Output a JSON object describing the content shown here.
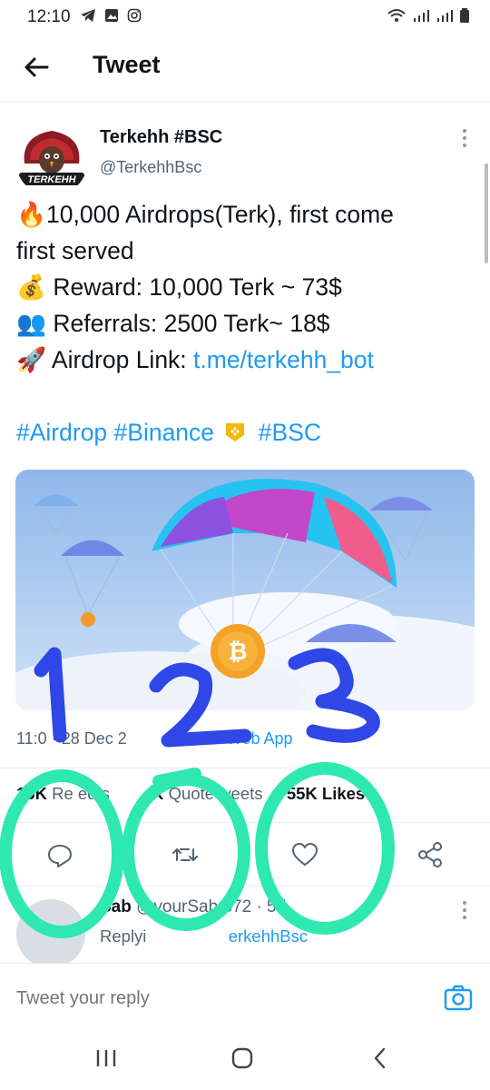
{
  "status_bar": {
    "time": "12:10",
    "left_icons": [
      "telegram-icon",
      "gallery-icon",
      "instagram-icon"
    ],
    "right_icons": [
      "wifi-icon",
      "signal-icon",
      "signal-icon",
      "battery-icon"
    ]
  },
  "app_bar": {
    "title": "Tweet"
  },
  "tweet": {
    "author_name": "Terkehh #BSC",
    "author_handle": "@TerkehhBsc",
    "avatar_text": "TERKEHH",
    "lines": [
      {
        "emoji": "🔥",
        "text": "10,000 Airdrops(Terk), first come"
      },
      {
        "emoji": "",
        "text": "first served"
      },
      {
        "emoji": "💰",
        "text": " Reward: 10,000 Terk ~ 73$"
      },
      {
        "emoji": "👥",
        "text": " Referrals: 2500 Terk~ 18$"
      },
      {
        "emoji": "🚀",
        "text": " Airdrop Link: ",
        "link": "t.me/terkehh_bot"
      }
    ],
    "hashtags": {
      "a": "#Airdrop #Binance",
      "b": "#BSC"
    },
    "meta_visible": {
      "time": "11:0",
      "date": "· 28 Dec 2",
      "source": "Web App"
    },
    "stats": {
      "retweets_count": "15K",
      "retweets_label": "Re  eets",
      "quote_count": "K",
      "quote_label": "Quote  weets",
      "likes_count": "55",
      "likes_label": "K Likes"
    }
  },
  "annotations": {
    "numbers": [
      "1",
      "2",
      "3"
    ],
    "color_numbers": "#2f47e6",
    "color_circles": "#2ee8b0"
  },
  "reply": {
    "name": "Sab",
    "handle": "@yourSab   572 · 5d",
    "replying": "Replyi",
    "replying_to": "erkehhBsc"
  },
  "composer": {
    "placeholder": "Tweet your reply"
  },
  "colors": {
    "accent": "#1d9bf0",
    "text": "#0f1419",
    "secondary": "#536471"
  }
}
